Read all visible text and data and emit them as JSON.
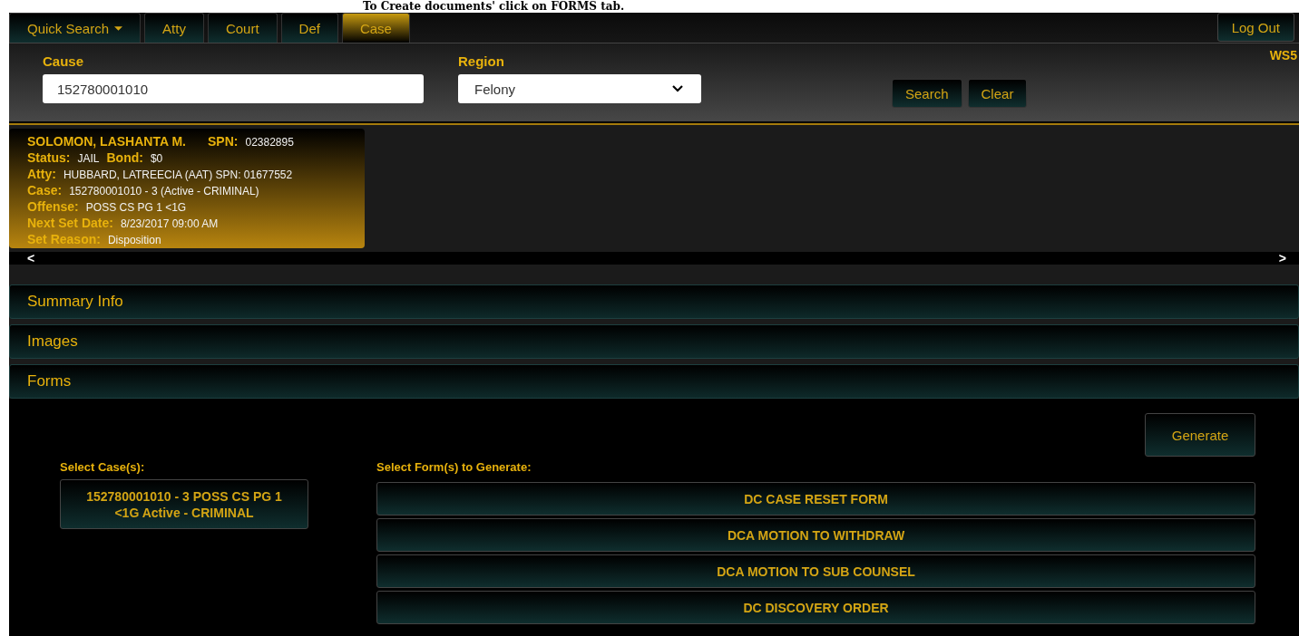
{
  "caption": "To Create documents' click on FORMS tab.",
  "nav": {
    "tabs": [
      {
        "label": "Quick Search",
        "selected": false,
        "dropdown": true
      },
      {
        "label": "Atty",
        "selected": false,
        "dropdown": false
      },
      {
        "label": "Court",
        "selected": false,
        "dropdown": false
      },
      {
        "label": "Def",
        "selected": false,
        "dropdown": false
      },
      {
        "label": "Case",
        "selected": true,
        "dropdown": false
      }
    ],
    "logout": "Log Out"
  },
  "search": {
    "cause_label": "Cause",
    "cause_value": "152780001010",
    "region_label": "Region",
    "region_value": "Felony",
    "buttons": [
      "Search",
      "Clear"
    ],
    "workstation": "WS5"
  },
  "case_card": {
    "name": "SOLOMON, LASHANTA M.",
    "lines": [
      [
        {
          "label": "SPN:",
          "value": "02382895"
        }
      ],
      [
        {
          "label": "Status:",
          "value": "JAIL"
        },
        {
          "label": "Bond:",
          "value": "$0"
        }
      ],
      [
        {
          "label": "Atty:",
          "value": "HUBBARD, LATREECIA (AAT) SPN: 01677552"
        }
      ],
      [
        {
          "label": "Case:",
          "value": "152780001010 - 3 (Active - CRIMINAL)"
        }
      ],
      [
        {
          "label": "Offense:",
          "value": "POSS CS PG 1 <1G"
        }
      ],
      [
        {
          "label": "Next Set Date:",
          "value": "8/23/2017 09:00 AM"
        }
      ],
      [
        {
          "label": "Set Reason:",
          "value": "Disposition"
        }
      ]
    ],
    "scroll_left": "<",
    "scroll_right": ">"
  },
  "sections": [
    {
      "title": "Summary Info",
      "expanded": false
    },
    {
      "title": "Images",
      "expanded": false
    },
    {
      "title": "Forms",
      "expanded": true
    }
  ],
  "forms": {
    "generate": "Generate",
    "cases_label": "Select Case(s):",
    "cases": [
      "152780001010 - 3 POSS CS PG 1 <1G Active - CRIMINAL"
    ],
    "forms_label": "Select Form(s) to Generate:",
    "form_list": [
      "DC CASE RESET FORM",
      "DCA MOTION TO WITHDRAW",
      "DCA MOTION TO SUB COUNSEL",
      "DC DISCOVERY ORDER"
    ]
  }
}
